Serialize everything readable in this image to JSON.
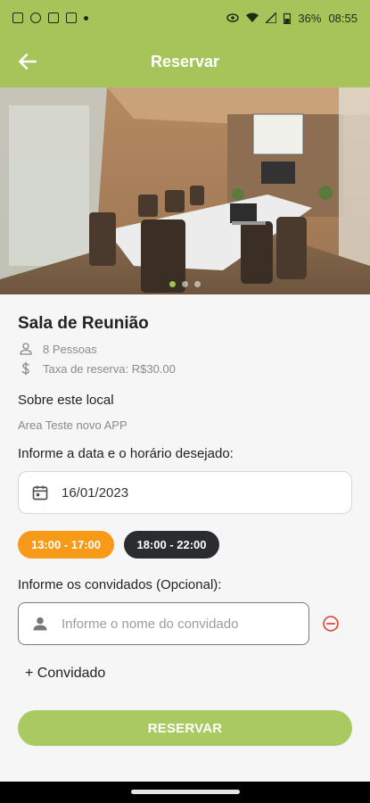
{
  "status_bar": {
    "battery": "36%",
    "time": "08:55",
    "icons": [
      "sim-icon",
      "whatsapp-icon",
      "u-icon",
      "u-icon",
      "dot-icon",
      "eye-icon",
      "wifi-icon",
      "signal-icon",
      "battery-icon"
    ]
  },
  "app_bar": {
    "title": "Reservar",
    "back_icon": "arrow-left-icon",
    "color": "#a6c45a"
  },
  "carousel": {
    "pages": 3,
    "active_index": 0,
    "active_color": "#9fc35a"
  },
  "room": {
    "name": "Sala de Reunião",
    "capacity": "8 Pessoas",
    "fee": "Taxa de reserva: R$30.00"
  },
  "about": {
    "title": "Sobre este local",
    "text": "Area Teste novo APP"
  },
  "schedule": {
    "prompt": "Informe a data e o horário desejado:",
    "date": "16/01/2023",
    "slots": [
      {
        "label": "13:00 - 17:00",
        "selected": true,
        "color": "#f79a18"
      },
      {
        "label": "18:00 - 22:00",
        "selected": false,
        "color": "#2a2c30"
      }
    ]
  },
  "guests": {
    "prompt": "Informe os convidados (Opcional):",
    "input_placeholder": "Informe o nome do convidado",
    "input_value": "",
    "add_label": "+ Convidado"
  },
  "submit": {
    "label": "RESERVAR",
    "color": "#a9c961"
  }
}
